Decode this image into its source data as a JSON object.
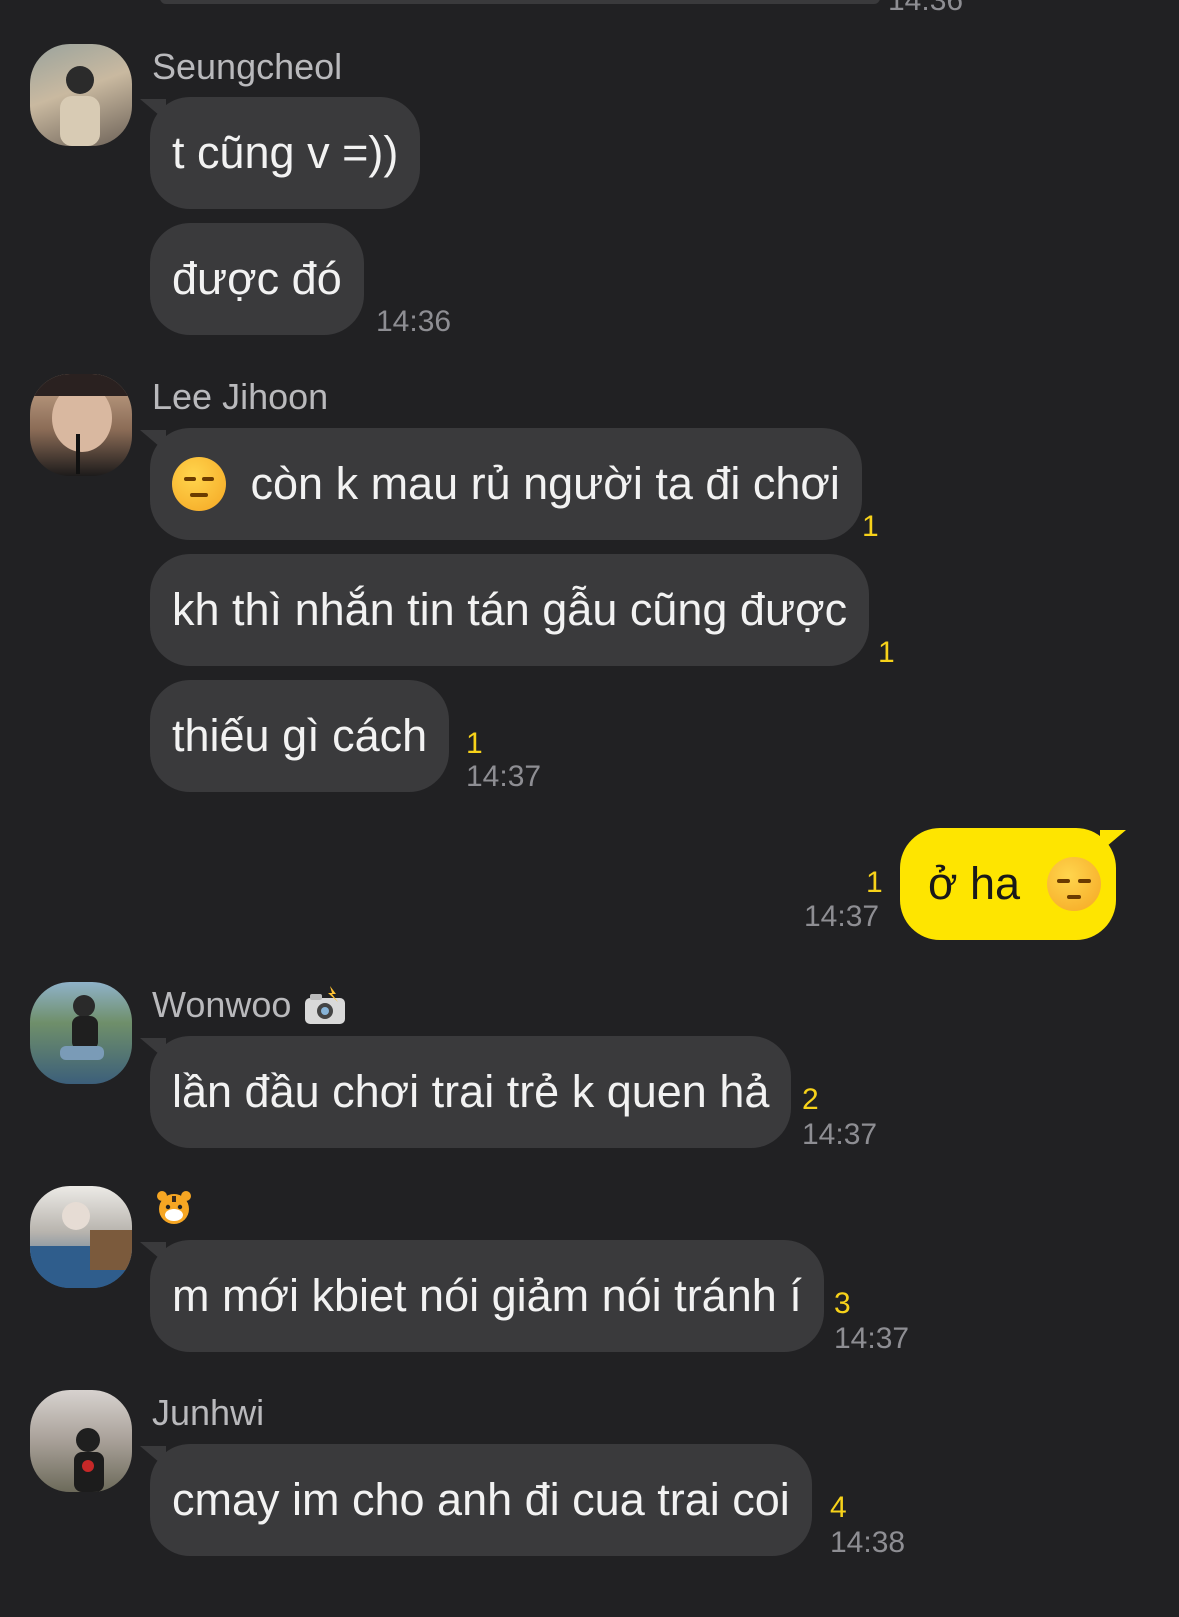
{
  "top_partial_time": "14:36",
  "messages": [
    {
      "sender": "Seungcheol",
      "bubbles": [
        "t cũng v =))",
        "được đó"
      ],
      "time": "14:36"
    },
    {
      "sender": "Lee Jihoon",
      "bubbles": [
        "còn k mau rủ người ta đi chơi",
        "kh thì nhắn tin tán gẫu cũng được",
        "thiếu gì cách"
      ],
      "unread": [
        "1",
        "1",
        "1"
      ],
      "time": "14:37",
      "first_emoji": "unamused-face"
    },
    {
      "sender": "me",
      "bubbles": [
        "ở ha"
      ],
      "unread": [
        "1"
      ],
      "time": "14:37",
      "emoji": "pensive-face"
    },
    {
      "sender": "Wonwoo",
      "sender_icon": "camera-flash-icon",
      "bubbles": [
        "lần đầu chơi trai trẻ k quen hả"
      ],
      "unread": [
        "2"
      ],
      "time": "14:37"
    },
    {
      "sender": "",
      "sender_icon": "tiger-face-icon",
      "bubbles": [
        "m mới kbiet nói giảm nói tránh í"
      ],
      "unread": [
        "3"
      ],
      "time": "14:37"
    },
    {
      "sender": "Junhwi",
      "bubbles": [
        "cmay im cho anh đi cua trai coi"
      ],
      "unread": [
        "4"
      ],
      "time": "14:38"
    }
  ],
  "colors": {
    "background": "#212123",
    "incoming_bubble": "#3a3a3c",
    "outgoing_bubble": "#fee500",
    "unread_count": "#f7d21a"
  }
}
